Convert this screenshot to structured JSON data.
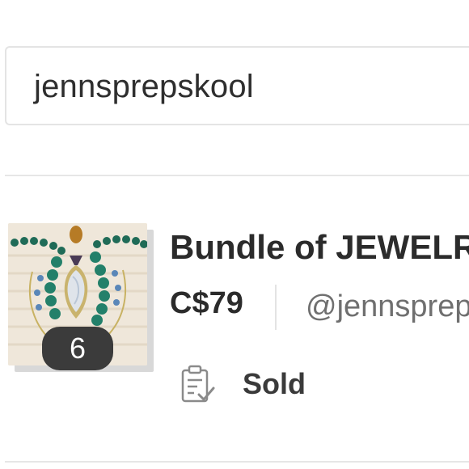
{
  "search": {
    "value": "jennsprepskool"
  },
  "listing": {
    "title": "Bundle of JEWELRY",
    "price": "C$79",
    "seller": "@jennsprepskool",
    "photo_count": "6",
    "status": "Sold",
    "status_icon": "clipboard-check-icon"
  }
}
